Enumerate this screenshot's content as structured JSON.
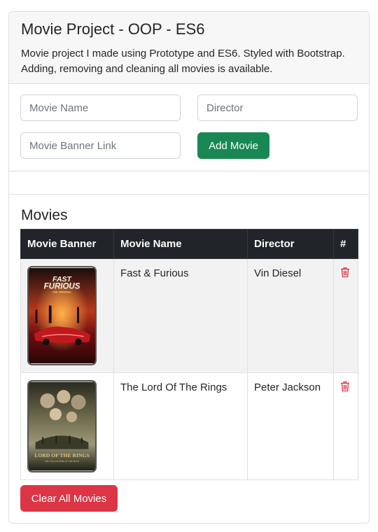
{
  "header": {
    "title": "Movie Project - OOP - ES6",
    "description": "Movie project I made using Prototype and ES6. Styled with Bootstrap. Adding, removing and cleaning all movies is available."
  },
  "form": {
    "movie_name_placeholder": "Movie Name",
    "director_placeholder": "Director",
    "banner_link_placeholder": "Movie Banner Link",
    "add_button_label": "Add Movie"
  },
  "movies": {
    "title": "Movies",
    "columns": [
      "Movie Banner",
      "Movie Name",
      "Director",
      "#"
    ],
    "rows": [
      {
        "banner_icon": "poster-fast-and-furious",
        "name": "Fast & Furious",
        "director": "Vin Diesel",
        "action_icon": "trash-icon"
      },
      {
        "banner_icon": "poster-lord-of-the-rings",
        "name": "The Lord Of The Rings",
        "director": "Peter Jackson",
        "action_icon": "trash-icon"
      }
    ],
    "clear_button_label": "Clear All Movies"
  },
  "colors": {
    "success": "#198754",
    "danger": "#dc3545",
    "table_head": "#212529"
  }
}
